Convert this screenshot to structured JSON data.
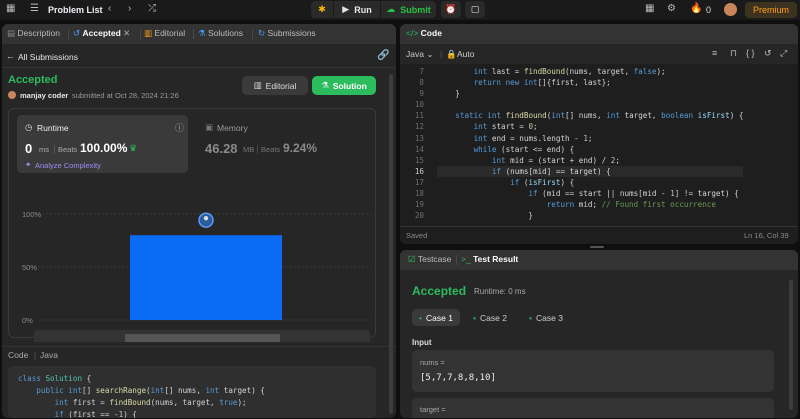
{
  "topbar": {
    "problem_list": "Problem List",
    "run": "Run",
    "submit": "Submit",
    "streak": "0",
    "premium": "Premium"
  },
  "left": {
    "tabs": [
      "Description",
      "Accepted",
      "Editorial",
      "Solutions",
      "Submissions"
    ],
    "back_label": "All Submissions",
    "status": "Accepted",
    "user": "manjay coder",
    "submitted": "submitted at Oct 28, 2024 21:26",
    "editorial_btn": "Editorial",
    "solution_btn": "Solution",
    "runtime_title": "Runtime",
    "runtime_value": "0",
    "runtime_unit": "ms",
    "beats_label": "Beats",
    "runtime_beats": "100.00%",
    "analyze": "Analyze Complexity",
    "memory_title": "Memory",
    "memory_value": "46.28",
    "memory_unit": "MB",
    "memory_beats": "9.24%",
    "code_label": "Code",
    "code_lang": "Java",
    "code_lines": [
      "class Solution {",
      "    public int[] searchRange(int[] nums, int target) {",
      "        int first = findBound(nums, target, true);",
      "        if (first == -1) {"
    ]
  },
  "chart_data": {
    "type": "bar",
    "yticks": [
      "100%",
      "50%",
      "0%"
    ],
    "ylim": [
      0,
      100
    ],
    "values": [
      80
    ],
    "grid": true
  },
  "editor": {
    "title": "Code",
    "lang": "Java",
    "mode": "Auto",
    "saved": "Saved",
    "cursor": "Ln 16, Col 39",
    "lines": [
      {
        "n": "7",
        "t": "        int last = findBound(nums, target, false);"
      },
      {
        "n": "8",
        "t": "        return new int[]{first, last};"
      },
      {
        "n": "9",
        "t": "    }"
      },
      {
        "n": "10",
        "t": ""
      },
      {
        "n": "11",
        "t": "    static int findBound(int[] nums, int target, boolean isFirst) {"
      },
      {
        "n": "12",
        "t": "        int start = 0;"
      },
      {
        "n": "13",
        "t": "        int end = nums.length - 1;"
      },
      {
        "n": "14",
        "t": "        while (start <= end) {"
      },
      {
        "n": "15",
        "t": "            int mid = (start + end) / 2;"
      },
      {
        "n": "16",
        "t": "            if (nums[mid] == target) {"
      },
      {
        "n": "17",
        "t": "                if (isFirst) {"
      },
      {
        "n": "18",
        "t": "                    if (mid == start || nums[mid - 1] != target) {"
      },
      {
        "n": "19",
        "t": "                        return mid; // Found first occurrence"
      },
      {
        "n": "20",
        "t": "                    }"
      }
    ]
  },
  "result": {
    "tab_testcase": "Testcase",
    "tab_result": "Test Result",
    "status": "Accepted",
    "runtime": "Runtime: 0 ms",
    "cases": [
      "Case 1",
      "Case 2",
      "Case 3"
    ],
    "input_label": "Input",
    "var1": "nums =",
    "val1": "[5,7,7,8,8,10]",
    "var2": "target ="
  },
  "colors": {
    "accent_green": "#2cbb5d",
    "bar_blue": "#0a6cf5",
    "submit_green": "#28c244"
  }
}
